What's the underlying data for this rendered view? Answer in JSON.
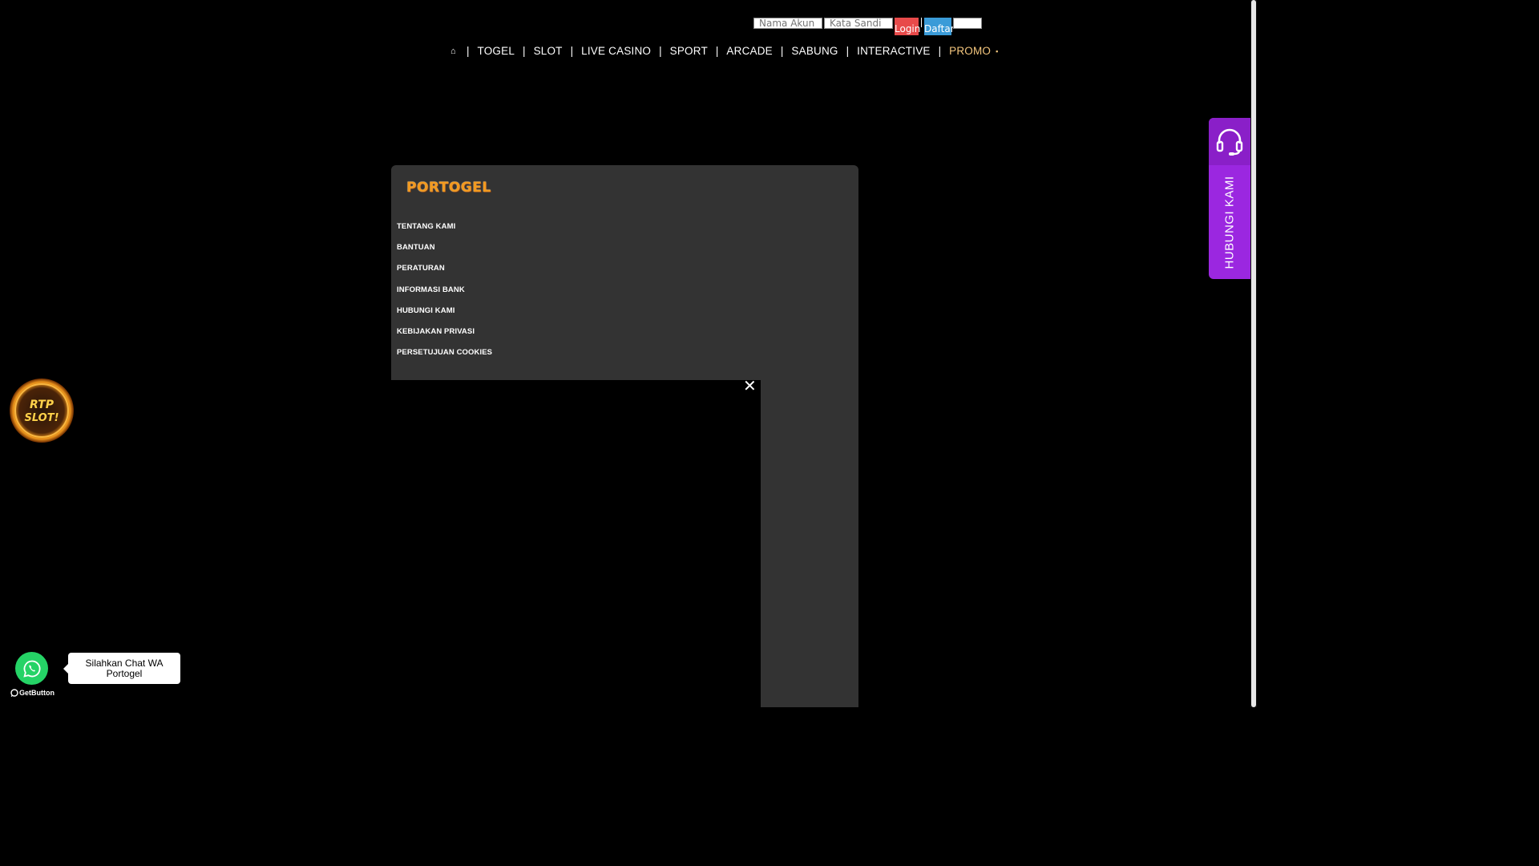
{
  "login": {
    "username_placeholder": "Nama Akun",
    "password_placeholder": "Kata Sandi",
    "login_label": "Login",
    "register_label": "Daftar"
  },
  "nav": {
    "separator": "|",
    "items": [
      "TOGEL",
      "SLOT",
      "LIVE CASINO",
      "SPORT",
      "ARCADE",
      "SABUNG",
      "INTERACTIVE"
    ],
    "promo": "PROMO"
  },
  "brand": {
    "logo_text": "PORTOGEL"
  },
  "footer_links": [
    "TENTANG KAMI",
    "BANTUAN",
    "PERATURAN",
    "INFORMASI BANK",
    "HUBUNGI KAMI",
    "KEBIJAKAN PRIVASI",
    "PERSETUJUAN COOKIES"
  ],
  "contact_widget": {
    "label": "HUBUNGI KAMI",
    "icon": "headset-icon",
    "color": "#9b27e0"
  },
  "rtp_badge": {
    "line1": "RTP",
    "line2": "SLOT!"
  },
  "whatsapp": {
    "bubble_text": "Silahkan Chat WA Portogel",
    "credit": "GetButton",
    "color": "#25d366"
  },
  "colors": {
    "login": "#e84a4a",
    "register": "#3a9bd8",
    "promo": "#f5c77e",
    "panel": "#333333"
  }
}
